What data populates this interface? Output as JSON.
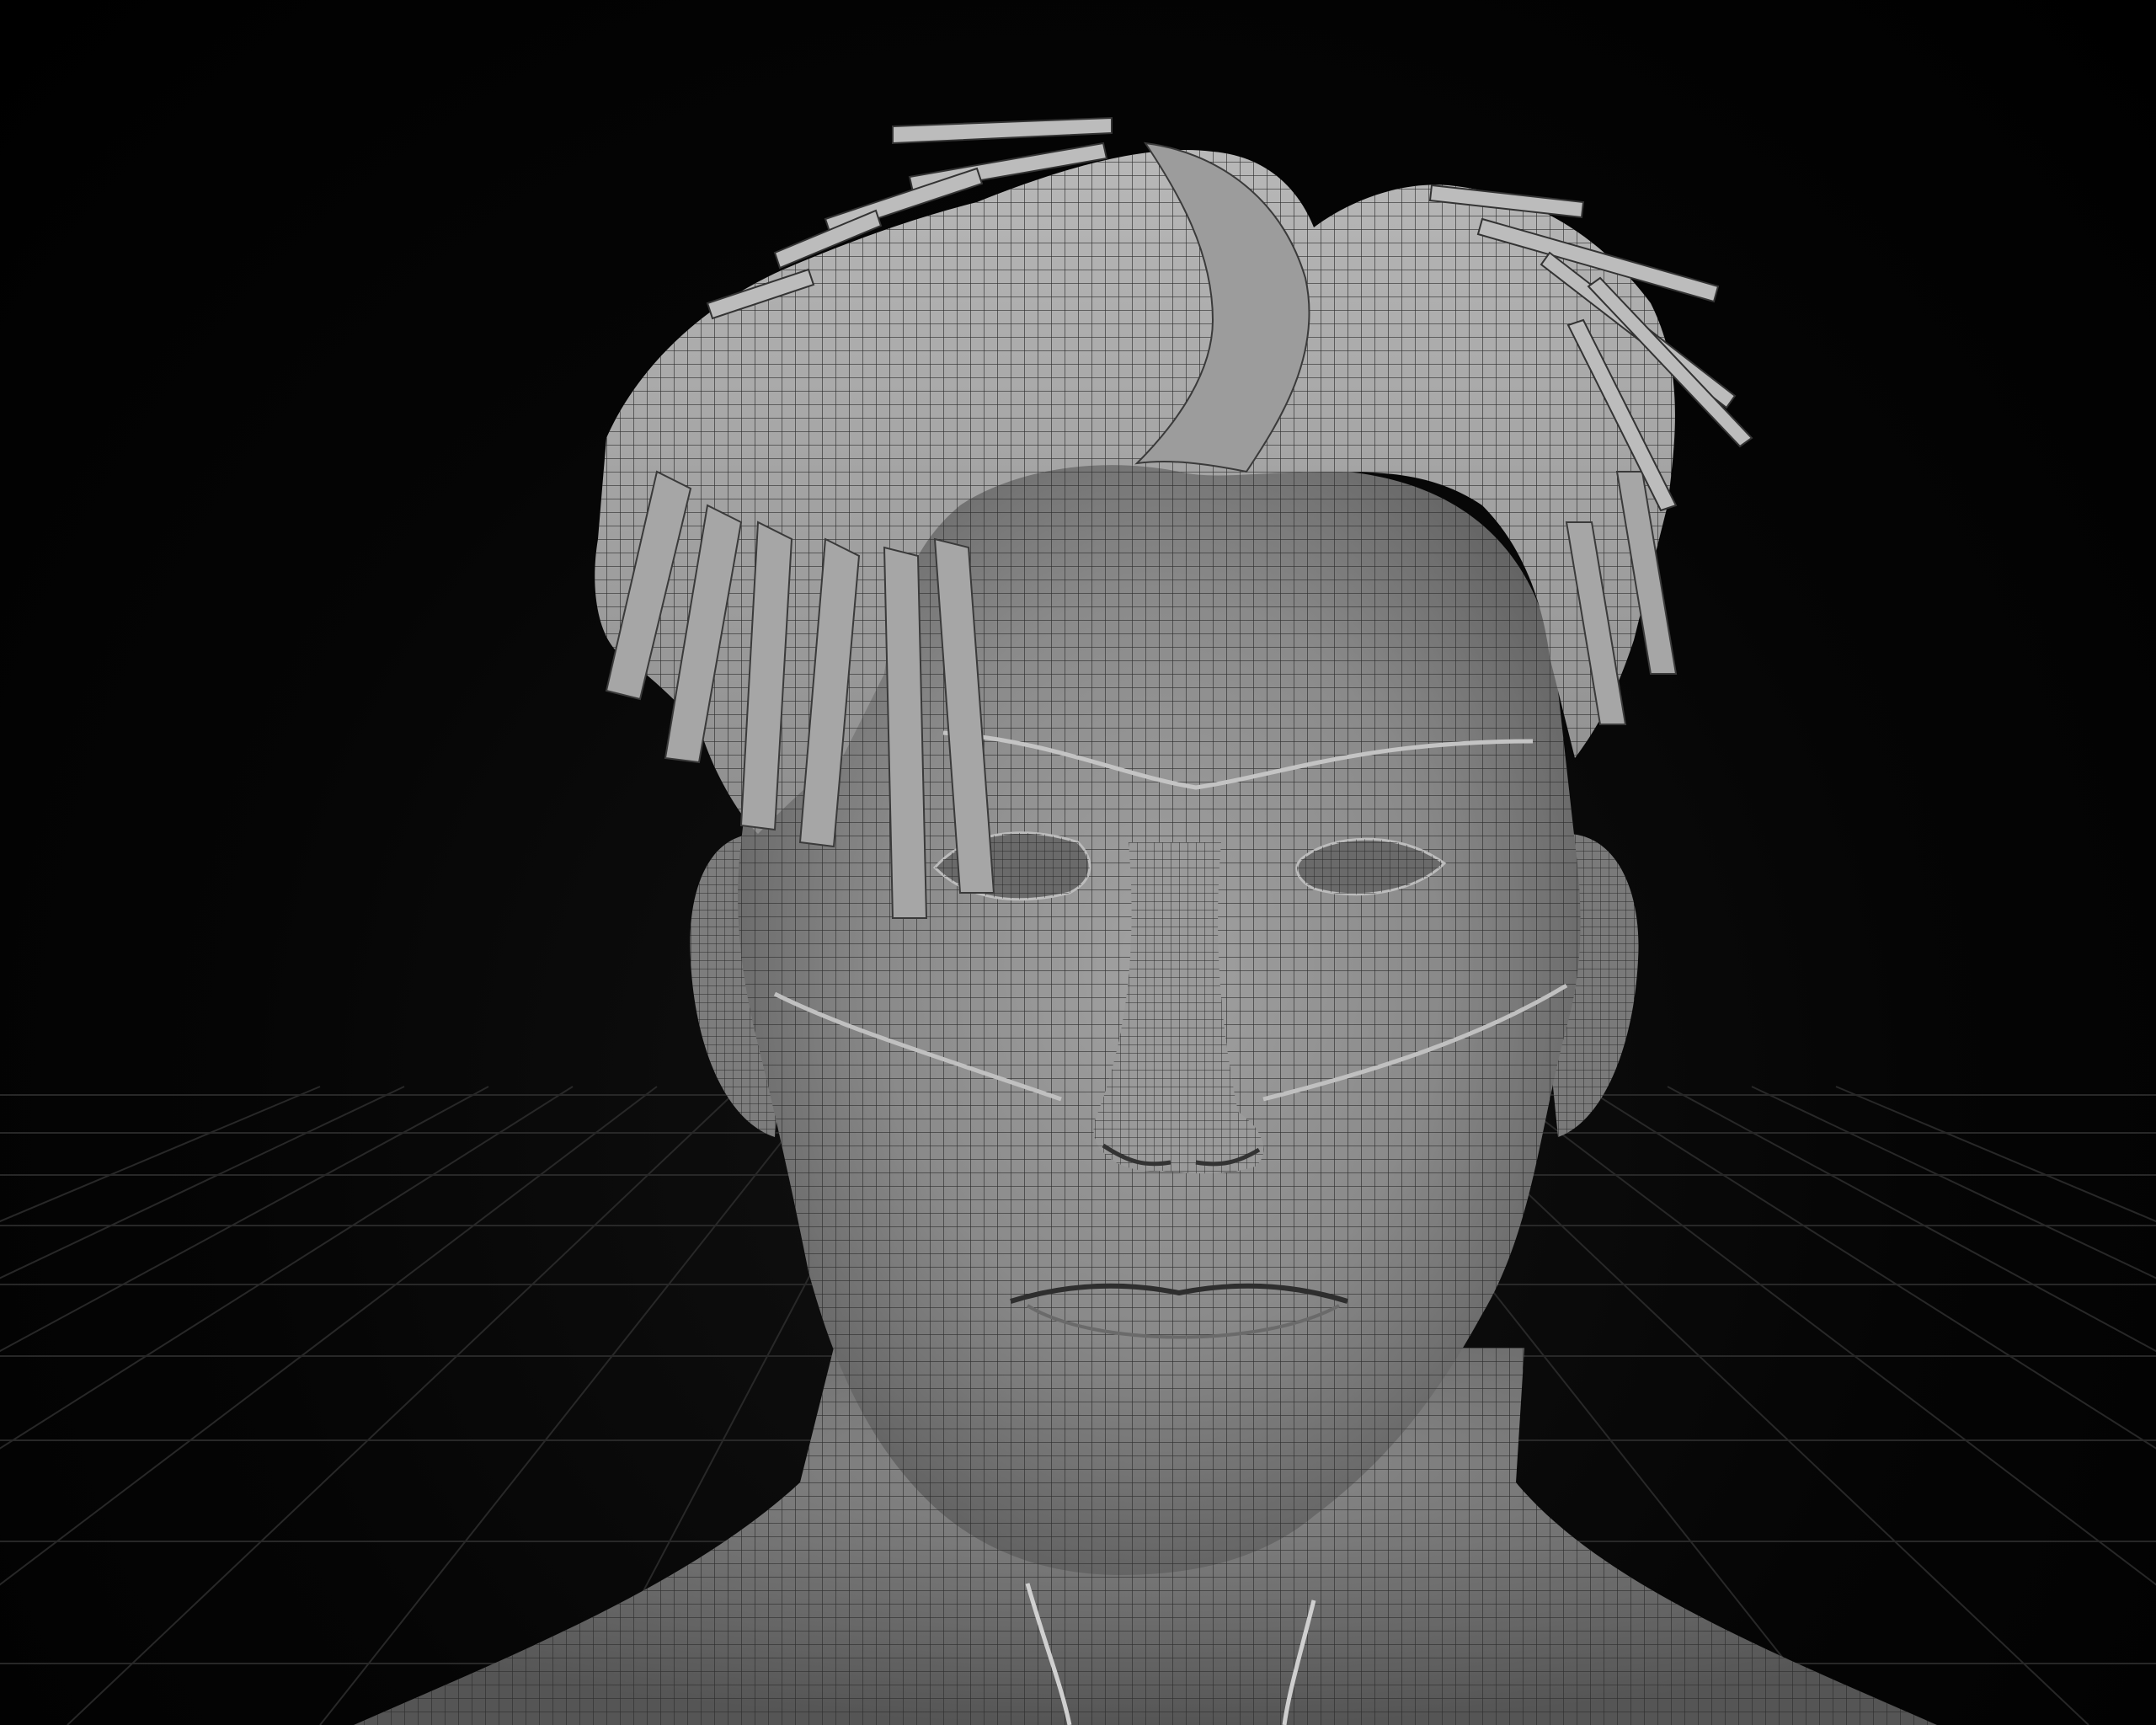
{
  "viewport": {
    "background_color": "#000000",
    "grid_color": "#3a3a3a",
    "model_color": "#8c8c8c",
    "wireframe_color": "#2a2a2a",
    "display_mode": "shaded-wireframe",
    "subject": "head-bust-with-hair-cards"
  }
}
